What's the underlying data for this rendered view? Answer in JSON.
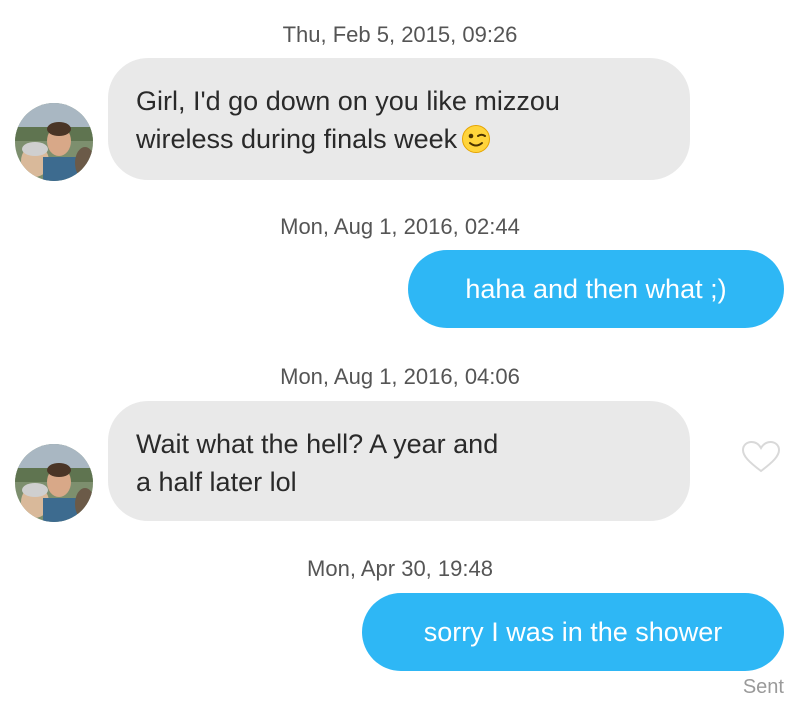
{
  "messages": [
    {
      "timestamp": "Thu, Feb 5, 2015, 09:26",
      "direction": "received",
      "lines": [
        "Girl, I'd go down on you like mizzou",
        "wireless during finals week"
      ],
      "emoji": "winking-face-icon"
    },
    {
      "timestamp": "Mon, Aug 1, 2016, 02:44",
      "direction": "sent",
      "text": "haha and then what ;)"
    },
    {
      "timestamp": "Mon, Aug 1, 2016, 04:06",
      "direction": "received",
      "lines": [
        "Wait what the hell? A year and",
        "a half later lol"
      ],
      "like_icon": "heart-outline-icon"
    },
    {
      "timestamp": "Mon, Apr 30, 19:48",
      "direction": "sent",
      "text": "sorry I was in the shower"
    }
  ],
  "status": "Sent",
  "colors": {
    "sent_bubble": "#2eb7f5",
    "received_bubble": "#e9e9e9",
    "timestamp_text": "#555555",
    "status_text": "#9a9a9a"
  }
}
